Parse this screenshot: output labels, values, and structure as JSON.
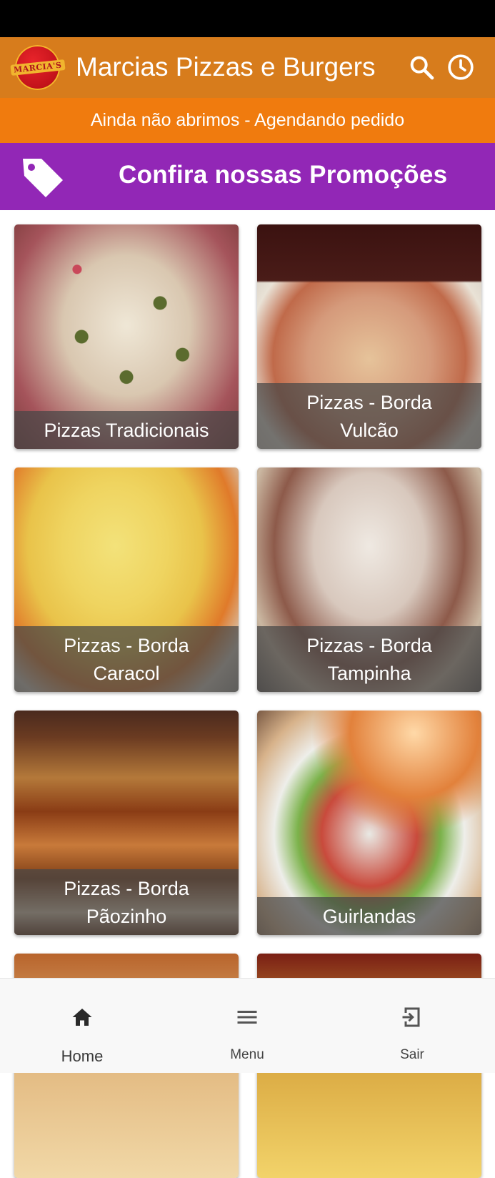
{
  "app_bar": {
    "title": "Marcias Pizzas e Burgers",
    "logo_text": "MARCIA'S"
  },
  "notice": "Ainda não abrimos - Agendando pedido",
  "promo": {
    "label": "Confira nossas Promoções",
    "icon": "tag-icon"
  },
  "categories": [
    {
      "label": "Pizzas Tradicionais"
    },
    {
      "label": "Pizzas - Borda Vulcão"
    },
    {
      "label": "Pizzas - Borda Caracol"
    },
    {
      "label": "Pizzas - Borda Tampinha"
    },
    {
      "label": "Pizzas - Borda Pãozinho"
    },
    {
      "label": "Guirlandas"
    },
    {
      "label": ""
    },
    {
      "label": ""
    }
  ],
  "bottom_nav": [
    {
      "label": "Home",
      "icon": "home-icon"
    },
    {
      "label": "Menu",
      "icon": "menu-icon"
    },
    {
      "label": "Sair",
      "icon": "exit-icon"
    }
  ],
  "colors": {
    "app_bar": "#d77c1c",
    "notice_bar": "#f07b0e",
    "promo_bar": "#9227b6"
  }
}
